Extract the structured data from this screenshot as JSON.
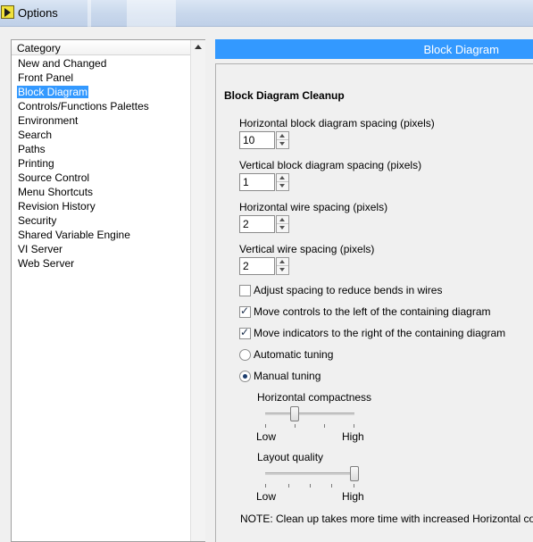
{
  "window": {
    "title": "Options"
  },
  "category": {
    "header": "Category",
    "items": [
      "New and Changed",
      "Front Panel",
      "Block Diagram",
      "Controls/Functions Palettes",
      "Environment",
      "Search",
      "Paths",
      "Printing",
      "Source Control",
      "Menu Shortcuts",
      "Revision History",
      "Security",
      "Shared Variable Engine",
      "VI Server",
      "Web Server"
    ],
    "selected": "Block Diagram"
  },
  "section": {
    "title": "Block Diagram"
  },
  "cleanup": {
    "group_title": "Block Diagram Cleanup",
    "h_block_label": "Horizontal block diagram spacing (pixels)",
    "h_block_value": "10",
    "v_block_label": "Vertical block diagram spacing (pixels)",
    "v_block_value": "1",
    "h_wire_label": "Horizontal wire spacing (pixels)",
    "h_wire_value": "2",
    "v_wire_label": "Vertical wire spacing (pixels)",
    "v_wire_value": "2",
    "adjust_bends_label": "Adjust spacing to reduce bends in wires",
    "adjust_bends_checked": false,
    "move_controls_label": "Move controls to the left of the containing diagram",
    "move_controls_checked": true,
    "move_indicators_label": "Move indicators to the right of the containing diagram",
    "move_indicators_checked": true,
    "automatic_tuning_label": "Automatic tuning",
    "manual_tuning_label": "Manual tuning",
    "tuning_selected": "manual",
    "horizontal_compactness": {
      "label": "Horizontal compactness",
      "low": "Low",
      "high": "High",
      "value": 0.33
    },
    "layout_quality": {
      "label": "Layout quality",
      "low": "Low",
      "high": "High",
      "value": 1.0
    },
    "note": "NOTE: Clean up takes more time with increased Horizontal co"
  },
  "colors": {
    "accent": "#3399ff",
    "selection": "#3399ff",
    "panel_bg": "#f0f0f0"
  }
}
